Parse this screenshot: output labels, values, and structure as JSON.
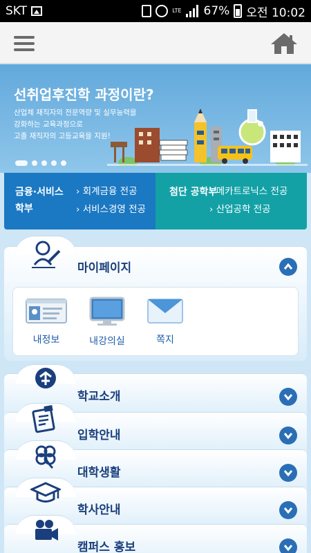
{
  "status_bar": {
    "carrier": "SKT",
    "network": "LTE",
    "battery": "67%",
    "time": "오전 10:02"
  },
  "header": {
    "menu_icon": "hamburger-icon",
    "home_icon": "home-icon"
  },
  "banner": {
    "title": "선취업후진학 과정이란?",
    "desc_lines": [
      "산업체 재직자의 전문역량 및 실무능력을",
      "강화하는 교육과정으로",
      "고졸 재직자의 고등교육을 지원!"
    ],
    "slide_count": 5,
    "active_slide": 0
  },
  "programs": [
    {
      "name": "금융·서비스 학부",
      "links": [
        "회계금융 전공",
        "서비스경영 전공"
      ],
      "color": "#1b78c3"
    },
    {
      "name": "첨단 공학부",
      "links": [
        "메카트로닉스 전공",
        "산업공학 전공"
      ],
      "color": "#13a1a6"
    }
  ],
  "accordion": [
    {
      "label": "마이페이지",
      "icon": "person-pen-icon",
      "expanded": true,
      "items": [
        {
          "label": "내정보",
          "icon": "id-card-icon"
        },
        {
          "label": "내강의실",
          "icon": "monitor-icon"
        },
        {
          "label": "쪽지",
          "icon": "envelope-icon"
        }
      ]
    },
    {
      "label": "학교소개",
      "icon": "school-emblem-icon",
      "expanded": false
    },
    {
      "label": "입학안내",
      "icon": "clipboard-icon",
      "expanded": false
    },
    {
      "label": "대학생활",
      "icon": "clover-icon",
      "expanded": false
    },
    {
      "label": "학사안내",
      "icon": "graduation-cap-icon",
      "expanded": false
    },
    {
      "label": "캠퍼스 홍보",
      "icon": "video-camera-icon",
      "expanded": false
    }
  ],
  "colors": {
    "accent": "#2a6fb6",
    "label": "#1a3f7c",
    "banner": "#62a9dc"
  }
}
